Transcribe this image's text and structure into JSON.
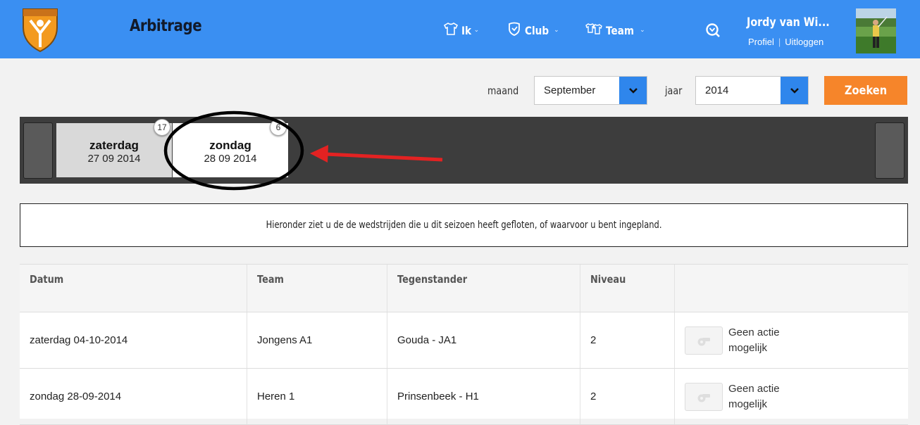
{
  "header": {
    "title": "Arbitrage",
    "nav": [
      {
        "label": "Ik"
      },
      {
        "label": "Club"
      },
      {
        "label": "Team"
      }
    ],
    "user": {
      "name": "Jordy van Wi...",
      "profile_link": "Profiel",
      "logout_link": "Uitloggen"
    }
  },
  "filters": {
    "month_label": "maand",
    "month_value": "September",
    "year_label": "jaar",
    "year_value": "2014",
    "search_button": "Zoeken"
  },
  "day_tabs": [
    {
      "day": "zaterdag",
      "date": "27 09 2014",
      "count": "17",
      "selected": false
    },
    {
      "day": "zondag",
      "date": "28 09 2014",
      "count": "6",
      "selected": true
    }
  ],
  "info_text": "Hieronder ziet u de de wedstrijden die u dit seizoen heeft gefloten, of waarvoor u bent ingepland.",
  "table": {
    "columns": [
      "Datum",
      "Team",
      "Tegenstander",
      "Niveau",
      ""
    ],
    "rows": [
      {
        "datum": "zaterdag 04-10-2014",
        "team": "Jongens A1",
        "tegenstander": "Gouda - JA1",
        "niveau": "2",
        "actie": "Geen actie mogelijk"
      },
      {
        "datum": "zondag 28-09-2014",
        "team": "Heren 1",
        "tegenstander": "Prinsenbeek - H1",
        "niveau": "2",
        "actie": "Geen actie mogelijk"
      }
    ]
  },
  "colors": {
    "header_blue": "#3a8ff2",
    "select_button_blue": "#2f86ec",
    "search_orange": "#f6852a",
    "daybar_dark": "#3d3d3d",
    "annotation_red": "#e32222"
  },
  "icons": {
    "logo": "club-logo-icon",
    "ik": "shirt-icon",
    "club": "shield-icon",
    "team": "shirts-icon",
    "search": "search-icon",
    "dropdown": "chevron-down-icon",
    "action": "whistle-icon"
  }
}
